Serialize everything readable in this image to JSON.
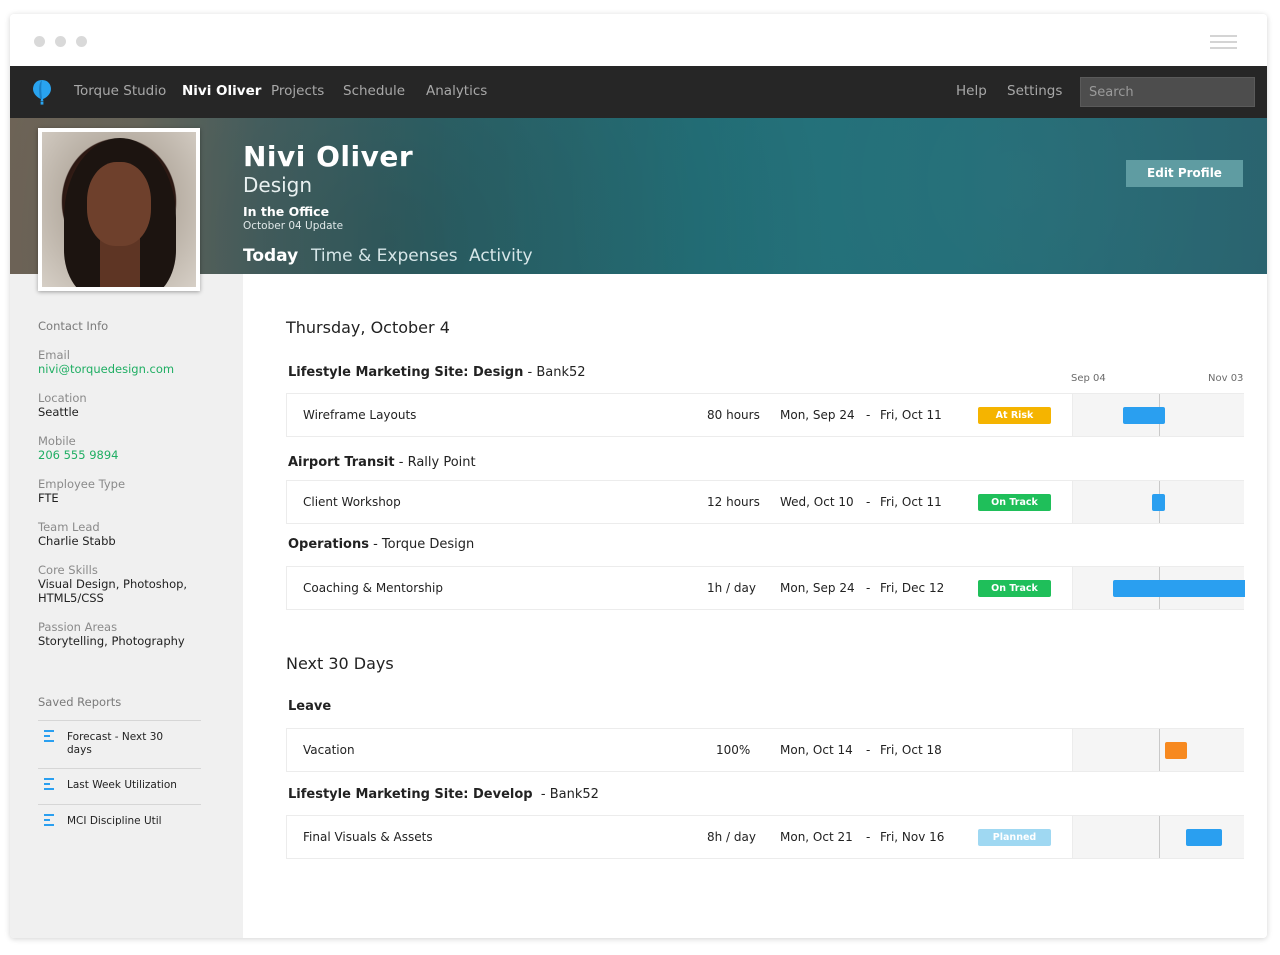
{
  "topnav": {
    "brand": "Torque Studio",
    "items": [
      {
        "label": "Nivi Oliver",
        "active": true
      },
      {
        "label": "Projects"
      },
      {
        "label": "Schedule"
      },
      {
        "label": "Analytics"
      }
    ],
    "right": [
      {
        "label": "Help"
      },
      {
        "label": "Settings"
      }
    ],
    "search_placeholder": "Search"
  },
  "profile": {
    "name": "Nivi Oliver",
    "department": "Design",
    "status": "In the Office",
    "update": "October 04 Update",
    "tabs": [
      {
        "label": "Today",
        "active": true
      },
      {
        "label": "Time & Expenses"
      },
      {
        "label": "Activity"
      }
    ],
    "edit_label": "Edit Profile"
  },
  "sidebar": {
    "contact_heading": "Contact Info",
    "fields": [
      {
        "label": "Email",
        "value": "nivi@torquedesign.com",
        "link": true
      },
      {
        "label": "Location",
        "value": "Seattle"
      },
      {
        "label": "Mobile",
        "value": "206 555 9894",
        "link": true
      },
      {
        "label": "Employee Type",
        "value": "FTE"
      },
      {
        "label": "Team Lead",
        "value": "Charlie Stabb"
      },
      {
        "label": "Core Skills",
        "value_lines": [
          "Visual Design, Photoshop,",
          "HTML5/CSS"
        ]
      },
      {
        "label": "Passion Areas",
        "value": "Storytelling, Photography"
      }
    ],
    "reports_heading": "Saved Reports",
    "reports": [
      {
        "line1": "Forecast - Next 30",
        "line2": "days"
      },
      {
        "line1": "Last Week Utilization"
      },
      {
        "line1": "MCI Discipline Util"
      }
    ]
  },
  "timeline": {
    "start": "Sep 04",
    "end": "Nov 03"
  },
  "colors": {
    "at_risk": "#f5b400",
    "on_track": "#1fbf5a",
    "planned": "#9fd8f2",
    "bar_blue": "#2a9ff0",
    "bar_orange": "#f7891f",
    "accent_green": "#1fae63"
  },
  "today": {
    "title": "Thursday, October 4",
    "groups": [
      {
        "project": "Lifestyle Marketing Site: Design",
        "client": "Bank52",
        "tasks": [
          {
            "name": "Wireframe Layouts",
            "hours": "80 hours",
            "start": "Mon, Sep 24",
            "end": "Fri, Oct 11",
            "status": "At Risk",
            "status_key": "at_risk"
          }
        ]
      },
      {
        "project": "Airport Transit",
        "client": "Rally Point",
        "tasks": [
          {
            "name": "Client Workshop",
            "hours": "12 hours",
            "start": "Wed, Oct 10",
            "end": "Fri, Oct 11",
            "status": "On Track",
            "status_key": "on_track"
          }
        ]
      },
      {
        "project": "Operations",
        "client": "Torque Design",
        "tasks": [
          {
            "name": "Coaching & Mentorship",
            "hours": "1h / day",
            "start": "Mon, Sep 24",
            "end": "Fri, Dec 12",
            "status": "On Track",
            "status_key": "on_track"
          }
        ]
      }
    ]
  },
  "next30": {
    "title": "Next 30 Days",
    "groups": [
      {
        "project": "Leave",
        "client": "",
        "tasks": [
          {
            "name": "Vacation",
            "hours": "100%",
            "start": "Mon, Oct 14",
            "end": "Fri, Oct 18",
            "status": "",
            "status_key": ""
          }
        ]
      },
      {
        "project": "Lifestyle Marketing Site: Develop",
        "client": "Bank52",
        "tasks": [
          {
            "name": "Final Visuals & Assets",
            "hours": "8h / day",
            "start": "Mon, Oct 21",
            "end": "Fri, Nov 16",
            "status": "Planned",
            "status_key": "planned"
          }
        ]
      }
    ]
  }
}
